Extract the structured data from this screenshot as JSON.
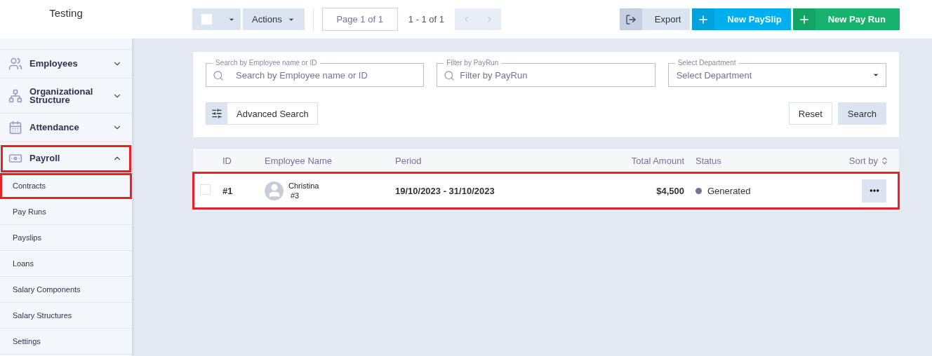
{
  "sidebar": {
    "company": "Testing",
    "items": [
      {
        "label": "Employees",
        "expanded": false,
        "highlighted": false
      },
      {
        "label": "Organizational Structure",
        "expanded": false,
        "highlighted": false
      },
      {
        "label": "Attendance",
        "expanded": false,
        "highlighted": false
      },
      {
        "label": "Payroll",
        "expanded": true,
        "highlighted": true,
        "children": [
          {
            "label": "Contracts",
            "highlighted": true
          },
          {
            "label": "Pay Runs",
            "highlighted": false
          },
          {
            "label": "Payslips",
            "highlighted": false
          },
          {
            "label": "Loans",
            "highlighted": false
          },
          {
            "label": "Salary Components",
            "highlighted": false
          },
          {
            "label": "Salary Structures",
            "highlighted": false
          },
          {
            "label": "Settings",
            "highlighted": false
          }
        ]
      }
    ]
  },
  "toolbar": {
    "select_all": {
      "checked": false
    },
    "actions": "Actions",
    "page": "Page 1 of 1",
    "range": "1 - 1 of 1",
    "export": "Export",
    "new_payslip": "New PaySlip",
    "new_pay_run": "New Pay Run"
  },
  "filters": {
    "fields": [
      {
        "kind": "search",
        "label": "Search by Employee name or ID",
        "placeholder": "Search by Employee name or ID"
      },
      {
        "kind": "search",
        "label": "Filter by PayRun",
        "placeholder": "Filter by PayRun"
      },
      {
        "kind": "select",
        "label": "Select Department",
        "placeholder": "Select Department"
      }
    ],
    "advanced": "Advanced Search",
    "reset": "Reset",
    "search": "Search"
  },
  "table": {
    "columns": [
      "ID",
      "Employee Name",
      "Period",
      "Total Amount",
      "Status"
    ],
    "sort": "Sort by",
    "rows": [
      {
        "checked": false,
        "highlighted": true,
        "id": "#1",
        "name": "Christina",
        "code": "#3",
        "period": "19/10/2023 - 31/10/2023",
        "amount": "$4,500",
        "status": "Generated",
        "color": "#747499"
      }
    ]
  }
}
